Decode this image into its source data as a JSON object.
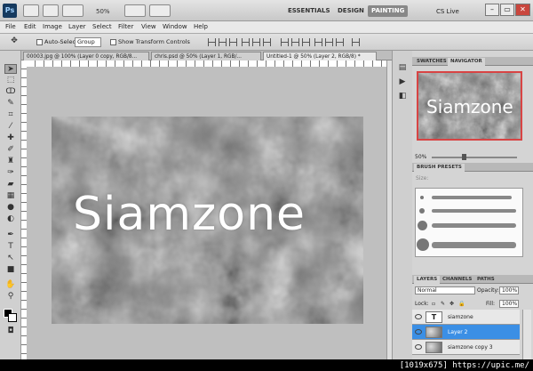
{
  "appbar": {
    "zoom": "50%",
    "workspaces": [
      "ESSENTIALS",
      "DESIGN",
      "PAINTING"
    ],
    "active_workspace": "PAINTING",
    "cs_live": "CS Live"
  },
  "menu": [
    "File",
    "Edit",
    "Image",
    "Layer",
    "Select",
    "Filter",
    "View",
    "Window",
    "Help"
  ],
  "options": {
    "auto_select_label": "Auto-Select:",
    "auto_select_value": "Group",
    "show_transform_label": "Show Transform Controls"
  },
  "doc_tabs": [
    "00003.jpg @ 100% (Layer 0 copy, RGB/8...",
    "chris.psd @ 50% (Layer 1, RGB/...",
    "Untitled-1 @ 50% (Layer 2, RGB/8) *"
  ],
  "canvas": {
    "text": "Siamzone"
  },
  "navigator": {
    "tabs": [
      "SWATCHES",
      "NAVIGATOR"
    ],
    "thumb_text": "Siamzone",
    "zoom": "50%"
  },
  "brushes": {
    "title": "BRUSH PRESETS",
    "size_label": "Size:"
  },
  "layers": {
    "tabs": [
      "LAYERS",
      "CHANNELS",
      "PATHS"
    ],
    "blend_mode": "Normal",
    "opacity_label": "Opacity:",
    "opacity": "100%",
    "lock_label": "Lock:",
    "fill_label": "Fill:",
    "fill": "100%",
    "items": [
      {
        "name": "siamzone",
        "thumb": "T"
      },
      {
        "name": "Layer 2",
        "thumb": ""
      },
      {
        "name": "siamzone copy 3",
        "thumb": ""
      }
    ]
  },
  "watermark": "[1019x675] https://upic.me/"
}
